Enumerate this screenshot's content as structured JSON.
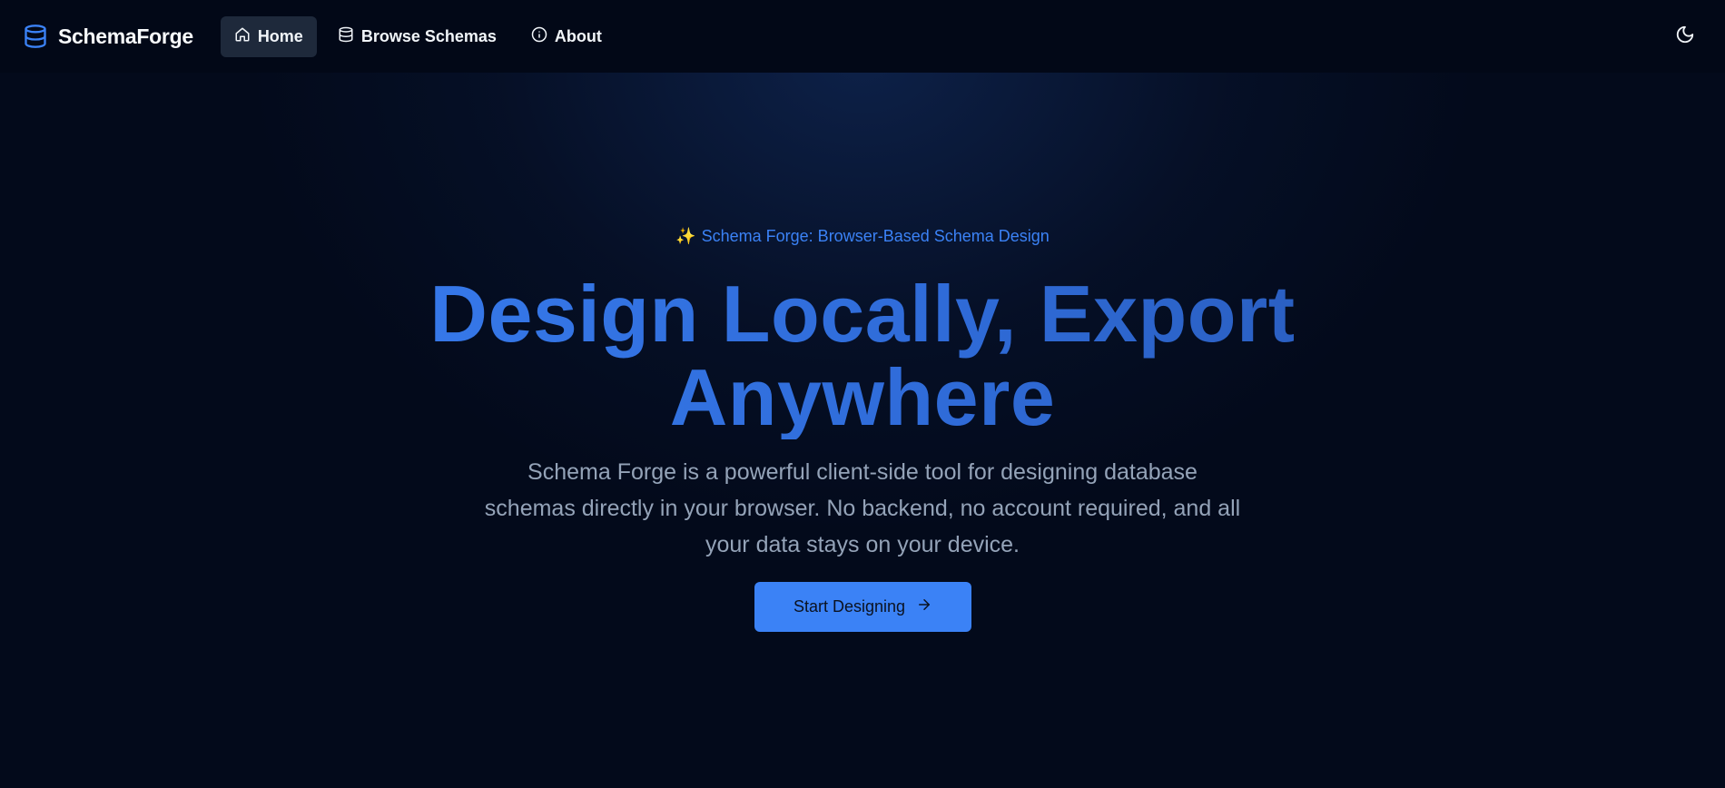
{
  "header": {
    "brand": "SchemaForge",
    "nav": [
      {
        "label": "Home",
        "icon": "home-icon",
        "active": true
      },
      {
        "label": "Browse Schemas",
        "icon": "database-icon",
        "active": false
      },
      {
        "label": "About",
        "icon": "info-icon",
        "active": false
      }
    ],
    "theme_toggle_icon": "moon-icon"
  },
  "hero": {
    "eyebrow_icon": "✨",
    "eyebrow": "Schema Forge: Browser-Based Schema Design",
    "headline_line1": "Design Locally, Export",
    "headline_line2": "Anywhere",
    "subtitle": "Schema Forge is a powerful client-side tool for designing database schemas directly in your browser. No backend, no account required, and all your data stays on your device.",
    "cta_label": "Start Designing",
    "cta_icon": "arrow-right-icon"
  },
  "colors": {
    "accent": "#3b82f6",
    "background": "#030a1b",
    "header_bg": "#020817",
    "active_nav_bg": "#1e293b",
    "muted_text": "#94a3b8"
  }
}
